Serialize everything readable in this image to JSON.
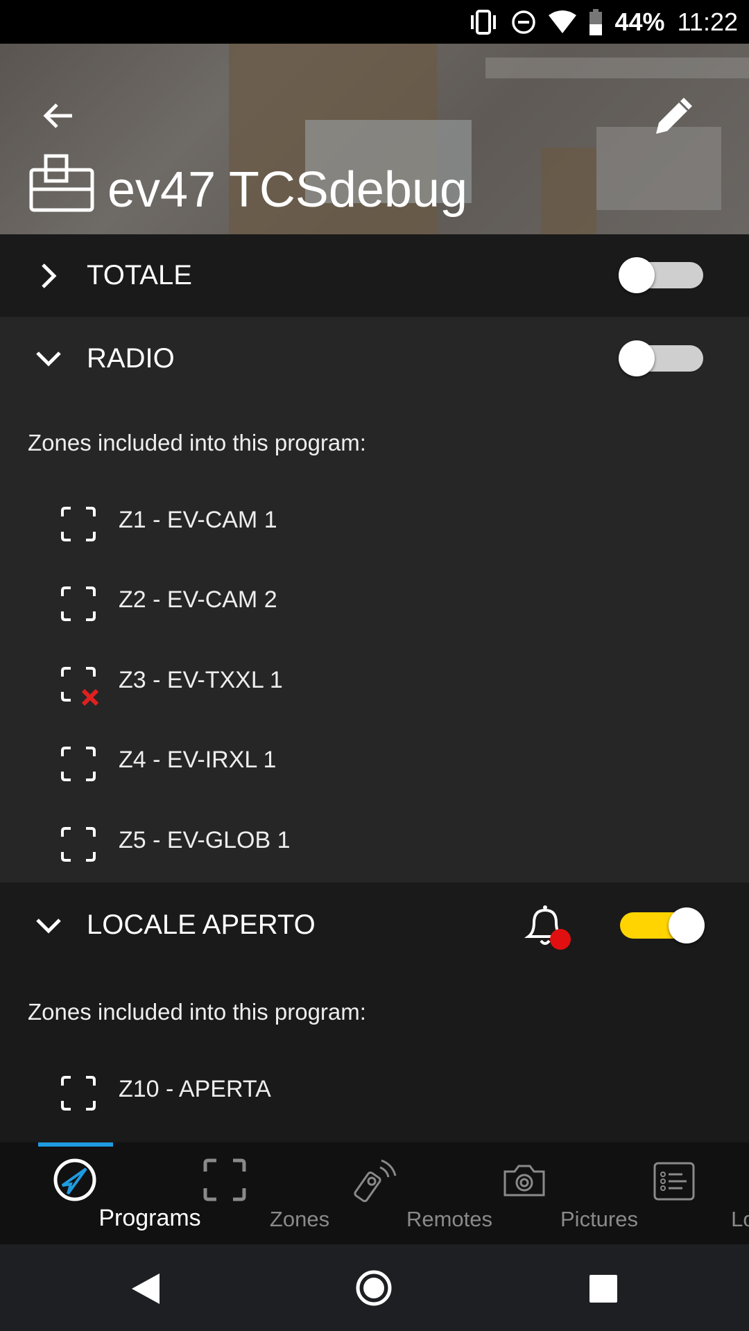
{
  "status_bar": {
    "battery": "44%",
    "time": "11:22",
    "icons": [
      "vibrate-icon",
      "dnd-icon",
      "wifi-icon",
      "battery-icon"
    ]
  },
  "header": {
    "title": "ev47 TCSdebug",
    "icons": [
      "back-arrow-icon",
      "edit-pencil-icon",
      "control-panel-icon"
    ]
  },
  "programs": [
    {
      "name": "TOTALE",
      "expanded": false,
      "enabled": false
    },
    {
      "name": "RADIO",
      "expanded": true,
      "enabled": false,
      "zones_label": "Zones included into this program:",
      "zones": [
        {
          "label": "Z1 - EV-CAM 1",
          "excluded": false
        },
        {
          "label": "Z2 - EV-CAM 2",
          "excluded": false
        },
        {
          "label": "Z3 - EV-TXXL 1",
          "excluded": true
        },
        {
          "label": "Z4 - EV-IRXL 1",
          "excluded": false
        },
        {
          "label": "Z5 - EV-GLOB 1",
          "excluded": false
        }
      ]
    },
    {
      "name": "LOCALE APERTO",
      "expanded": true,
      "enabled": true,
      "alarm": true,
      "zones_label": "Zones included into this program:",
      "zones": [
        {
          "label": "Z10 - APERTA",
          "excluded": false
        }
      ]
    }
  ],
  "bottom_nav": {
    "active": "Programs",
    "accent": "#1e9be0",
    "tabs": [
      {
        "label": "Programs"
      },
      {
        "label": "Zones"
      },
      {
        "label": "Remotes"
      },
      {
        "label": "Pictures"
      },
      {
        "label": "Log"
      }
    ]
  },
  "colors": {
    "toggle_on": "#ffd400",
    "alarm_dot": "#e01010",
    "excluded_x": "#e02020"
  }
}
